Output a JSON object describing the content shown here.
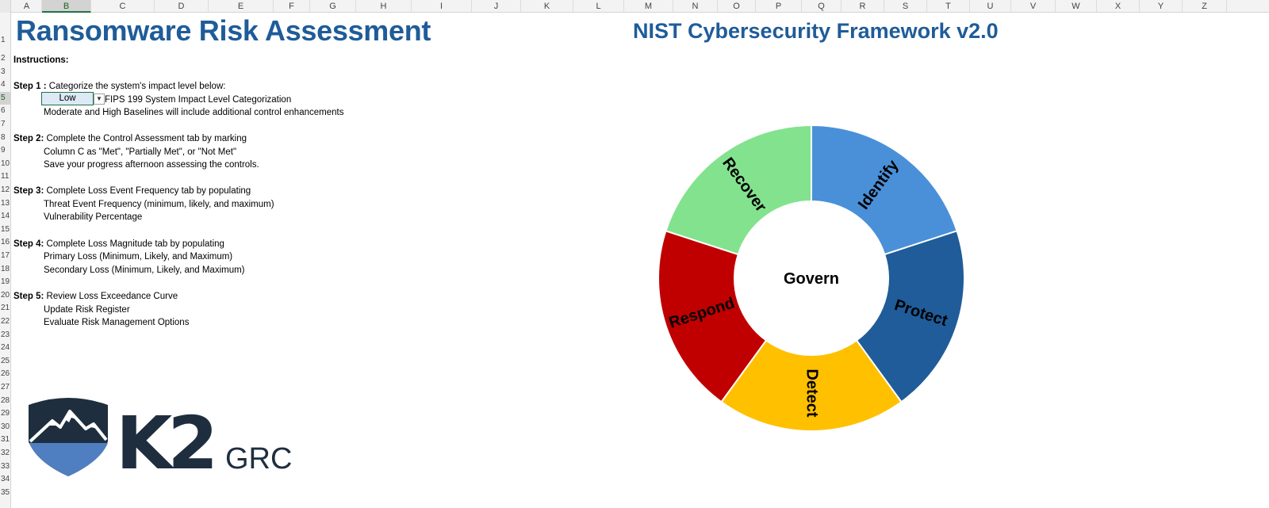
{
  "spreadsheet": {
    "columns": [
      "A",
      "B",
      "C",
      "D",
      "E",
      "F",
      "G",
      "H",
      "I",
      "J",
      "K",
      "L",
      "M",
      "N",
      "O",
      "P",
      "Q",
      "R",
      "S",
      "T",
      "U",
      "V",
      "W",
      "X",
      "Y",
      "Z"
    ],
    "active_column": "B",
    "rows": [
      "1",
      "2",
      "3",
      "4",
      "5",
      "6",
      "7",
      "8",
      "9",
      "10",
      "11",
      "12",
      "13",
      "14",
      "15",
      "16",
      "17",
      "18",
      "19",
      "20",
      "21",
      "22",
      "23",
      "24",
      "25",
      "26",
      "27",
      "28",
      "29",
      "30",
      "31",
      "32",
      "33",
      "34",
      "35"
    ],
    "active_row": "5"
  },
  "sheet": {
    "title": "Ransomware Risk Assessment",
    "instructions_label": "Instructions:",
    "step1": {
      "label": "Step 1 :",
      "text": " Categorize the system's impact level below:",
      "impact_value": "Low",
      "impact_caption": "FIPS 199 System Impact Level Categorization",
      "note": "Moderate and High Baselines will include additional control enhancements"
    },
    "step2": {
      "label": "Step 2:",
      "text": " Complete the Control Assessment tab by marking",
      "line2": "Column C as \"Met\", \"Partially Met\", or \"Not Met\"",
      "line3": "Save your progress afternoon assessing the controls."
    },
    "step3": {
      "label": "Step 3:",
      "text": " Complete  Loss Event Frequency tab by populating",
      "line2": "Threat Event Frequency (minimum, likely, and maximum)",
      "line3": "Vulnerability Percentage"
    },
    "step4": {
      "label": "Step 4:",
      "text": " Complete Loss Magnitude tab by populating",
      "line2": "Primary Loss (Minimum, Likely, and Maximum)",
      "line3": "Secondary Loss (Minimum, Likely, and Maximum)"
    },
    "step5": {
      "label": "Step 5:",
      "text": " Review Loss Exceedance Curve",
      "line2": "Update Risk Register",
      "line3": "Evaluate Risk Management Options"
    }
  },
  "logo": {
    "brand": "K2",
    "suffix": "GRC",
    "colors": {
      "dark": "#1e2e3e",
      "blue": "#4f7fc0"
    }
  },
  "chart_data": {
    "type": "pie",
    "title": "NIST Cybersecurity Framework v2.0",
    "center_label": "Govern",
    "categories": [
      "Identify",
      "Protect",
      "Detect",
      "Respond",
      "Recover"
    ],
    "values": [
      20,
      20,
      20,
      20,
      20
    ],
    "colors": [
      "#4a90d9",
      "#1f5c99",
      "#ffc000",
      "#c00000",
      "#83e28e"
    ]
  }
}
